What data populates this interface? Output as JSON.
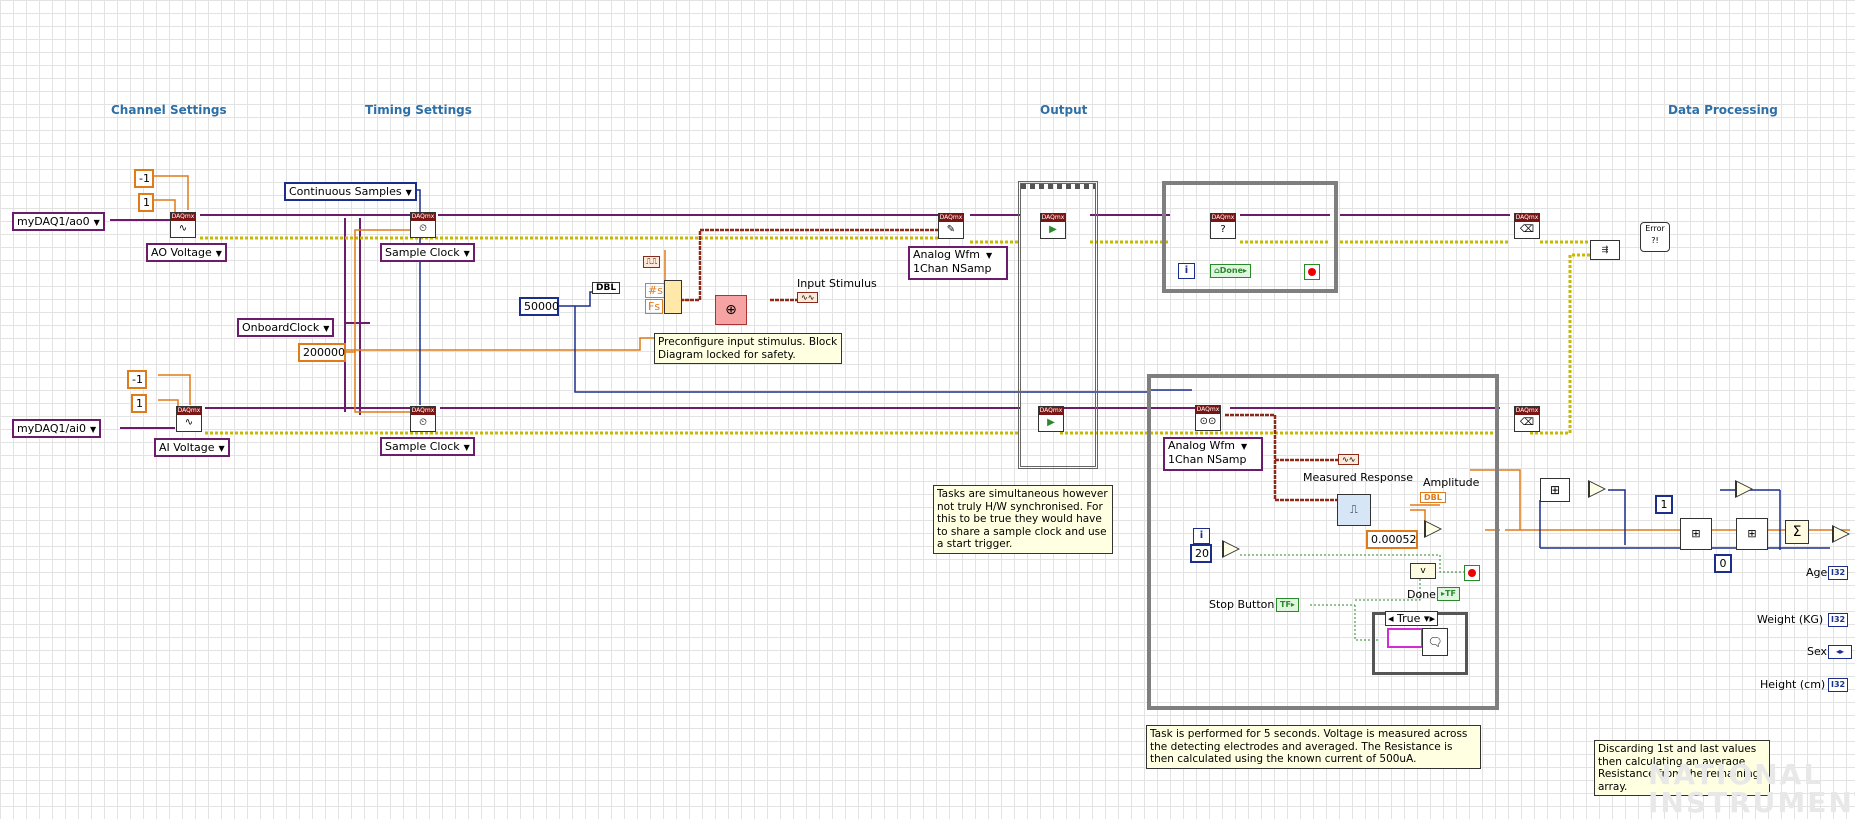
{
  "sections": {
    "channel": "Channel Settings",
    "timing": "Timing Settings",
    "output": "Output",
    "processing": "Data Processing"
  },
  "controls": {
    "ao_channel": "myDAQ1/ao0",
    "ai_channel": "myDAQ1/ai0",
    "ao_type": "AO Voltage",
    "ai_type": "AI Voltage",
    "sample_mode": "Continuous Samples",
    "sample_clock_1": "Sample Clock",
    "sample_clock_2": "Sample Clock",
    "clock_source": "OnboardClock",
    "rate": "200000",
    "const_neg1_a": "-1",
    "const_1_a": "1",
    "const_neg1_b": "-1",
    "const_1_b": "1",
    "samples": "50000",
    "dbl_label": "DBL",
    "fs_label": "Fs",
    "ns_label": "#s",
    "input_stimulus": "Input Stimulus",
    "write_mode_line1": "Analog Wfm",
    "write_mode_line2": "1Chan NSamp",
    "read_mode_line1": "Analog Wfm",
    "read_mode_line2": "1Chan NSamp",
    "done": "Done",
    "done2": "Done",
    "measured_response": "Measured Response",
    "amplitude": "Amplitude",
    "dbl_ind": "DBL",
    "current": "0.00052",
    "count_20": "20",
    "stop_button": "Stop Button",
    "case_true": "True",
    "iter_i": "i",
    "const_1_c": "1",
    "const_0": "0",
    "age": "Age",
    "weight": "Weight (KG)",
    "sex": "Sex",
    "height": "Height (cm)",
    "i32": "I32",
    "error_label": "Error"
  },
  "notes": {
    "stimulus": "Preconfigure input stimulus. Block Diagram locked for safety.",
    "tasks": "Tasks are simultaneous however not truly H/W synchronised. For this to be true they would have to share a sample clock and use a start trigger.",
    "task_performed": "Task is performed for 5 seconds. Voltage is measured across the detecting electrodes and averaged. The Resistance is then calculated using the known current of 500uA.",
    "discarding": "Discarding 1st and last values then calculating an average Resistance from the remaining array."
  },
  "watermark": {
    "line1": "NATIONAL",
    "line2": "INSTRUMENTS"
  },
  "colors": {
    "task_wire": "#6d1c6d",
    "error_wire": "#c9b800",
    "numeric_dbl": "#e07b1a",
    "numeric_int": "#1b2e8c",
    "boolean": "#2a8a2a",
    "waveform": "#8b2a1a"
  }
}
